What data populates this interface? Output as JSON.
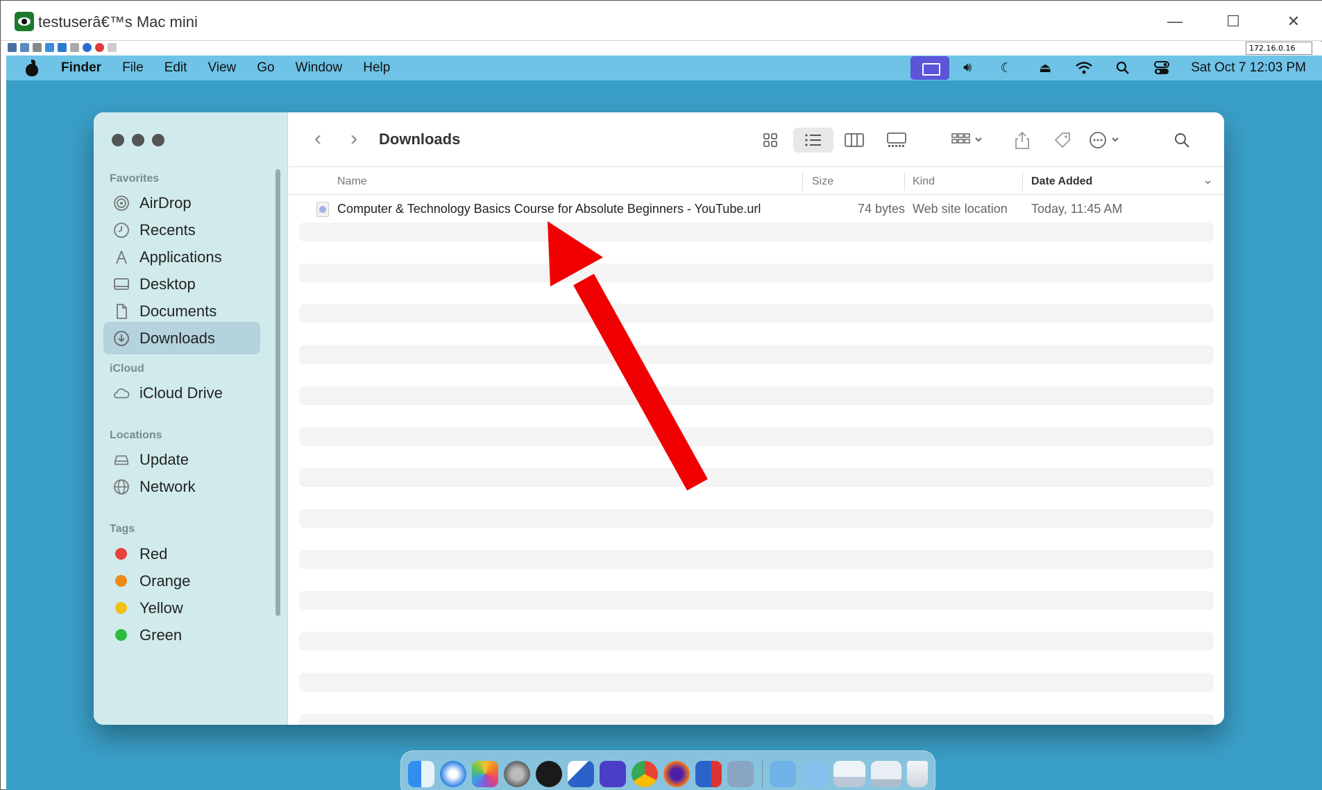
{
  "viewer": {
    "title": "testuserâ€™s Mac mini",
    "ip_field": "172.16.0.16",
    "controls": {
      "minimize": "—",
      "maximize": "☐",
      "close": "✕"
    }
  },
  "menubar": {
    "app_name": "Finder",
    "menus": [
      "File",
      "Edit",
      "View",
      "Go",
      "Window",
      "Help"
    ],
    "datetime": "Sat Oct 7  12:03 PM"
  },
  "finder": {
    "folder_title": "Downloads",
    "sidebar": {
      "favorites_label": "Favorites",
      "favorites": [
        {
          "label": "AirDrop",
          "icon": "airdrop-icon"
        },
        {
          "label": "Recents",
          "icon": "clock-icon"
        },
        {
          "label": "Applications",
          "icon": "applications-icon"
        },
        {
          "label": "Desktop",
          "icon": "desktop-icon"
        },
        {
          "label": "Documents",
          "icon": "document-icon"
        },
        {
          "label": "Downloads",
          "icon": "download-icon",
          "selected": true
        }
      ],
      "icloud_label": "iCloud",
      "icloud": [
        {
          "label": "iCloud Drive",
          "icon": "cloud-icon"
        }
      ],
      "locations_label": "Locations",
      "locations": [
        {
          "label": "Update",
          "icon": "drive-icon"
        },
        {
          "label": "Network",
          "icon": "globe-icon"
        }
      ],
      "tags_label": "Tags",
      "tags": [
        {
          "label": "Red",
          "color": "#e9403a"
        },
        {
          "label": "Orange",
          "color": "#ee8a16"
        },
        {
          "label": "Yellow",
          "color": "#f2c014"
        },
        {
          "label": "Green",
          "color": "#2fbb40"
        }
      ]
    },
    "columns": {
      "name": "Name",
      "size": "Size",
      "kind": "Kind",
      "date_added": "Date Added"
    },
    "files": [
      {
        "name": "Computer & Technology Basics Course for Absolute Beginners - YouTube.url",
        "size": "74 bytes",
        "kind": "Web site location",
        "date_added": "Today, 11:45 AM"
      }
    ]
  },
  "colors": {
    "desktop": "#3a9fc8",
    "menubar": "#6ec3e6",
    "sidebar": "#d1ebec",
    "annotation_arrow": "#f00000"
  }
}
